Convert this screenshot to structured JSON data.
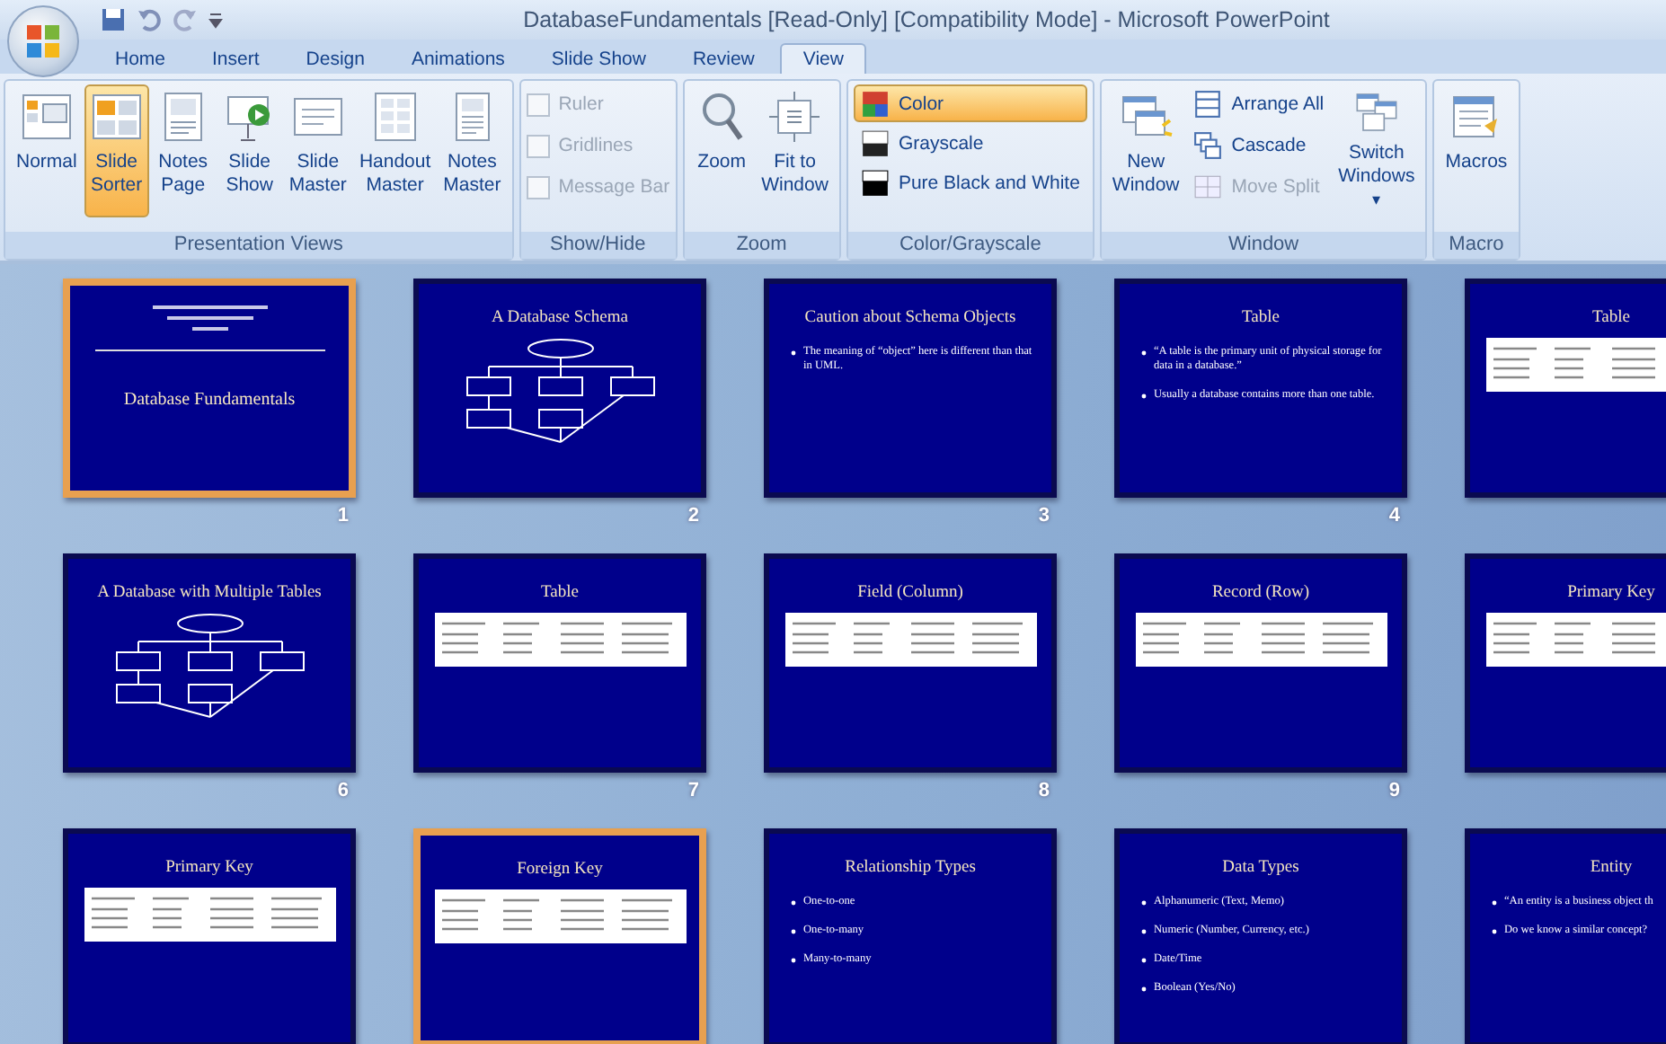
{
  "window": {
    "title": "DatabaseFundamentals [Read-Only] [Compatibility Mode] - Microsoft PowerPoint"
  },
  "tabs": [
    {
      "label": "Home",
      "selected": false
    },
    {
      "label": "Insert",
      "selected": false
    },
    {
      "label": "Design",
      "selected": false
    },
    {
      "label": "Animations",
      "selected": false
    },
    {
      "label": "Slide Show",
      "selected": false
    },
    {
      "label": "Review",
      "selected": false
    },
    {
      "label": "View",
      "selected": true
    }
  ],
  "ribbon": {
    "groups": [
      {
        "label": "Presentation Views",
        "items": [
          {
            "kind": "large",
            "label": "Normal",
            "selected": false
          },
          {
            "kind": "large",
            "label": "Slide Sorter",
            "selected": true
          },
          {
            "kind": "large",
            "label": "Notes Page",
            "selected": false
          },
          {
            "kind": "large",
            "label": "Slide Show",
            "selected": false
          },
          {
            "kind": "large",
            "label": "Slide Master",
            "selected": false
          },
          {
            "kind": "large",
            "label": "Handout Master",
            "selected": false
          },
          {
            "kind": "large",
            "label": "Notes Master",
            "selected": false
          }
        ]
      },
      {
        "label": "Show/Hide",
        "items": [
          {
            "kind": "checkbox",
            "label": "Ruler",
            "checked": false,
            "disabled": true
          },
          {
            "kind": "checkbox",
            "label": "Gridlines",
            "checked": false,
            "disabled": true
          },
          {
            "kind": "checkbox",
            "label": "Message Bar",
            "checked": false,
            "disabled": true
          }
        ]
      },
      {
        "label": "Zoom",
        "items": [
          {
            "kind": "large",
            "label": "Zoom"
          },
          {
            "kind": "large",
            "label": "Fit to Window"
          }
        ]
      },
      {
        "label": "Color/Grayscale",
        "items": [
          {
            "kind": "small",
            "label": "Color",
            "selected": true
          },
          {
            "kind": "small",
            "label": "Grayscale",
            "selected": false
          },
          {
            "kind": "small",
            "label": "Pure Black and White",
            "selected": false
          }
        ]
      },
      {
        "label": "Window",
        "items": [
          {
            "kind": "large",
            "label": "New Window"
          },
          {
            "kind": "stack",
            "items": [
              {
                "label": "Arrange All",
                "disabled": false
              },
              {
                "label": "Cascade",
                "disabled": false
              },
              {
                "label": "Move Split",
                "disabled": true
              }
            ]
          },
          {
            "kind": "large",
            "label": "Switch Windows",
            "dropdown": "▾"
          }
        ]
      },
      {
        "label": "Macro",
        "items": [
          {
            "kind": "large",
            "label": "Macros"
          }
        ]
      }
    ]
  },
  "slides": [
    {
      "kind": "title",
      "title": "Database Fundamentals",
      "number": "1",
      "selected": true
    },
    {
      "kind": "diagram",
      "title": "A Database Schema",
      "number": "2",
      "selected": false
    },
    {
      "kind": "bullets",
      "title": "Caution about Schema Objects",
      "bullets": [
        "The meaning of “object” here is different than that in UML."
      ],
      "number": "3",
      "selected": false
    },
    {
      "kind": "bullets",
      "title": "Table",
      "bullets": [
        "“A table is the primary unit of physical storage for data in a database.”",
        "Usually a database contains more than one table."
      ],
      "number": "4",
      "selected": false
    },
    {
      "kind": "table",
      "title": "Table",
      "selected": false
    },
    {
      "kind": "diagram",
      "title": "A Database with Multiple Tables",
      "number": "6",
      "selected": false
    },
    {
      "kind": "table",
      "title": "Table",
      "number": "7",
      "selected": false
    },
    {
      "kind": "table",
      "title": "Field (Column)",
      "number": "8",
      "selected": false
    },
    {
      "kind": "table",
      "title": "Record (Row)",
      "number": "9",
      "selected": false
    },
    {
      "kind": "table",
      "title": "Primary Key",
      "selected": false
    },
    {
      "kind": "table",
      "title": "Primary Key",
      "selected": false
    },
    {
      "kind": "table",
      "title": "Foreign Key",
      "selected": true
    },
    {
      "kind": "bullets",
      "title": "Relationship Types",
      "bullets": [
        "One-to-one",
        "One-to-many",
        "Many-to-many"
      ],
      "selected": false
    },
    {
      "kind": "bullets",
      "title": "Data Types",
      "bullets": [
        "Alphanumeric (Text, Memo)",
        "Numeric (Number, Currency, etc.)",
        "Date/Time",
        "Boolean (Yes/No)"
      ],
      "selected": false
    },
    {
      "kind": "bullets",
      "title": "Entity",
      "bullets": [
        "“An entity is a business object th",
        "Do we know a similar concept?"
      ],
      "selected": false
    }
  ]
}
